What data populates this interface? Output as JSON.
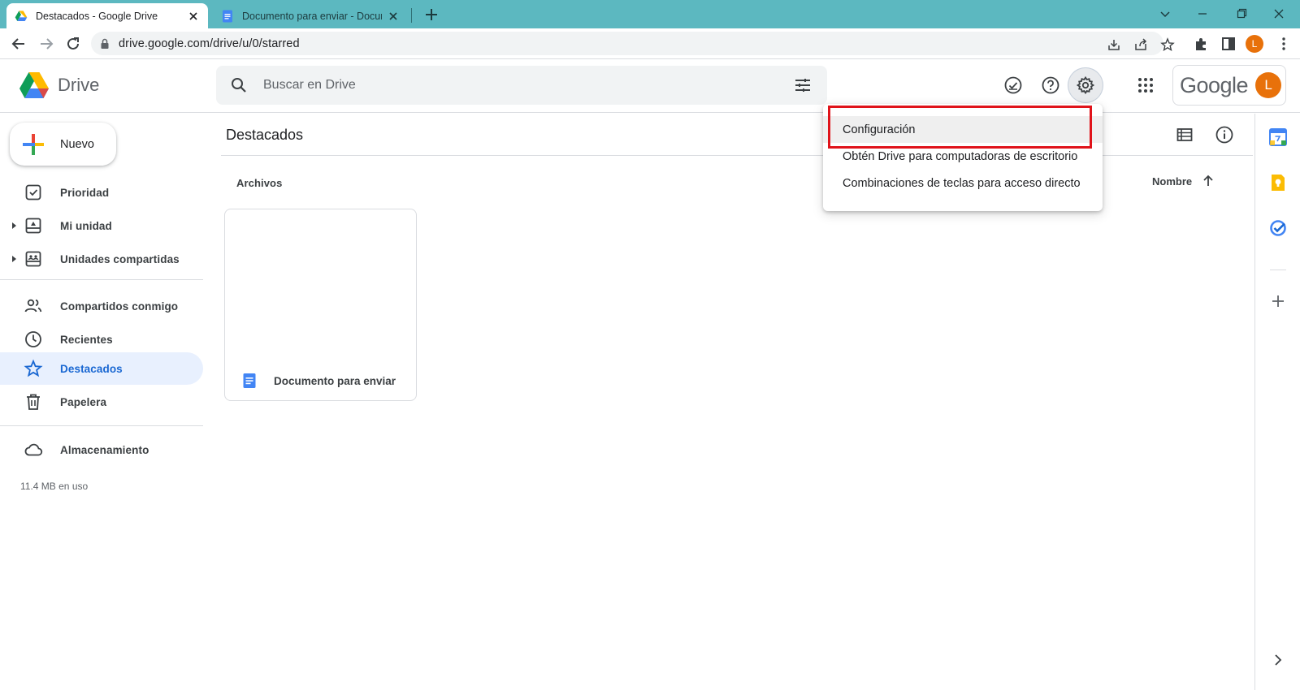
{
  "browser": {
    "tabs": [
      {
        "title": "Destacados - Google Drive",
        "active": true
      },
      {
        "title": "Documento para enviar - Documentos",
        "active": false
      }
    ],
    "url": "drive.google.com/drive/u/0/starred",
    "profile_initial": "L"
  },
  "header": {
    "brand": "Drive",
    "search_placeholder": "Buscar en Drive",
    "account_word": "Google",
    "avatar_initial": "L"
  },
  "sidebar": {
    "new_label": "Nuevo",
    "items": [
      {
        "label": "Prioridad"
      },
      {
        "label": "Mi unidad"
      },
      {
        "label": "Unidades compartidas"
      },
      {
        "label": "Compartidos conmigo"
      },
      {
        "label": "Recientes"
      },
      {
        "label": "Destacados",
        "active": true
      },
      {
        "label": "Papelera"
      },
      {
        "label": "Almacenamiento"
      }
    ],
    "storage_used": "11.4 MB en uso"
  },
  "main": {
    "title": "Destacados",
    "section": "Archivos",
    "sort_label": "Nombre",
    "files": [
      {
        "name": "Documento para enviar"
      }
    ]
  },
  "settings_menu": {
    "items": [
      {
        "label": "Configuración",
        "highlighted": true
      },
      {
        "label": "Obtén Drive para computadoras de escritorio"
      },
      {
        "label": "Combinaciones de teclas para acceso directo"
      }
    ]
  },
  "colors": {
    "tabstrip": "#5cb8c0",
    "accent_blue": "#1967d2",
    "active_nav_bg": "#e8f0fe",
    "highlight_box": "#e0131a",
    "avatar": "#e8710a"
  }
}
